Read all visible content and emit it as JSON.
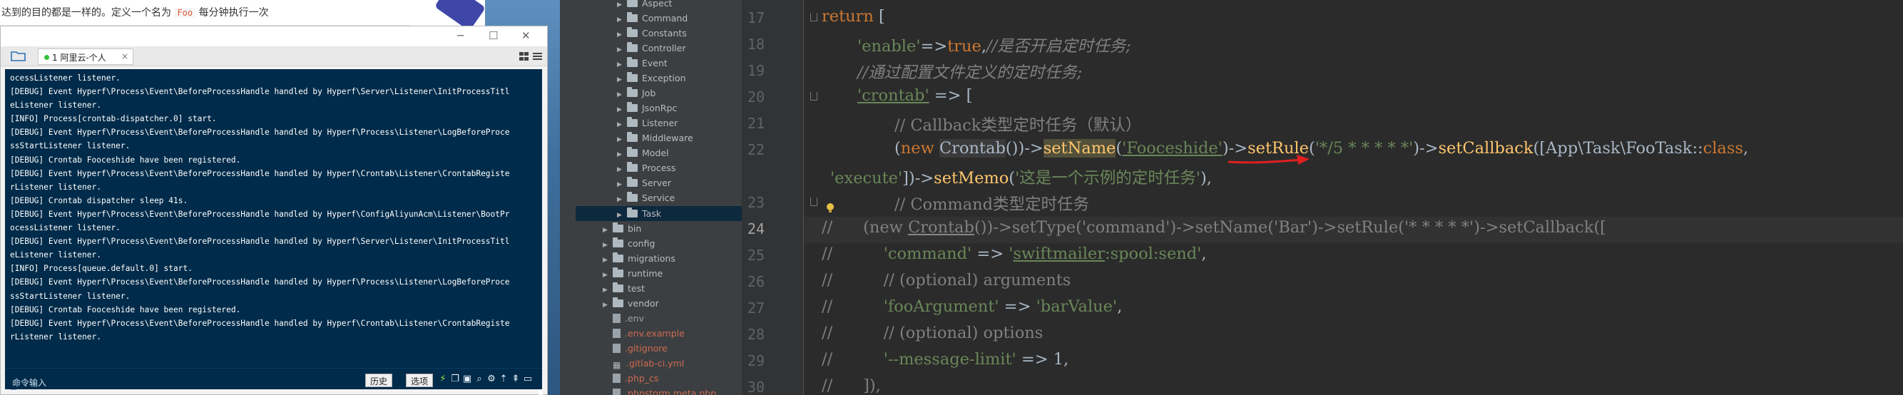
{
  "doc": {
    "text_before": "达到的目的都是一样的。定义一个名为",
    "foo_tag": "Foo",
    "text_after": "每分钟执行一次"
  },
  "terminal": {
    "tab_label": "1 阿里云-个人",
    "lines": [
      "ocessListener listener.",
      "[DEBUG] Event Hyperf\\Process\\Event\\BeforeProcessHandle handled by Hyperf\\Server\\Listener\\InitProcessTitl",
      "eListener listener.",
      "[INFO] Process[crontab-dispatcher.0] start.",
      "[DEBUG] Event Hyperf\\Process\\Event\\BeforeProcessHandle handled by Hyperf\\Process\\Listener\\LogBeforeProce",
      "ssStartListener listener.",
      "[DEBUG] Crontab Fooceshide have been registered.",
      "[DEBUG] Event Hyperf\\Process\\Event\\BeforeProcessHandle handled by Hyperf\\Crontab\\Listener\\CrontabRegiste",
      "rListener listener.",
      "[DEBUG] Crontab dispatcher sleep 41s.",
      "[DEBUG] Event Hyperf\\Process\\Event\\BeforeProcessHandle handled by Hyperf\\ConfigAliyunAcm\\Listener\\BootPr",
      "ocessListener listener.",
      "[DEBUG] Event Hyperf\\Process\\Event\\BeforeProcessHandle handled by Hyperf\\Server\\Listener\\InitProcessTitl",
      "eListener listener.",
      "[INFO] Process[queue.default.0] start.",
      "[DEBUG] Event Hyperf\\Process\\Event\\BeforeProcessHandle handled by Hyperf\\Process\\Listener\\LogBeforeProce",
      "ssStartListener listener.",
      "[DEBUG] Crontab Fooceshide have been registered.",
      "[DEBUG] Event Hyperf\\Process\\Event\\BeforeProcessHandle handled by Hyperf\\Crontab\\Listener\\CrontabRegiste",
      "rListener listener."
    ],
    "cmd_placeholder": "命令输入",
    "history_btn": "历史",
    "options_btn": "选项"
  },
  "tree": {
    "app_children": [
      "Aspect",
      "Command",
      "Constants",
      "Controller",
      "Event",
      "Exception",
      "Job",
      "JsonRpc",
      "Listener",
      "Middleware",
      "Model",
      "Process",
      "Server",
      "Service",
      "Task"
    ],
    "root_folders": [
      "bin",
      "config",
      "migrations",
      "runtime",
      "test",
      "vendor"
    ],
    "root_files": [
      ".env",
      ".env.example",
      ".gitignore",
      ".gitlab-ci.yml",
      ".php_cs",
      ".phpstorm.meta.php"
    ]
  },
  "editor": {
    "line_numbers": [
      "17",
      "18",
      "19",
      "20",
      "21",
      "22",
      "",
      "23",
      "24",
      "25",
      "26",
      "27",
      "28",
      "29",
      "30"
    ],
    "current_line": "24"
  }
}
